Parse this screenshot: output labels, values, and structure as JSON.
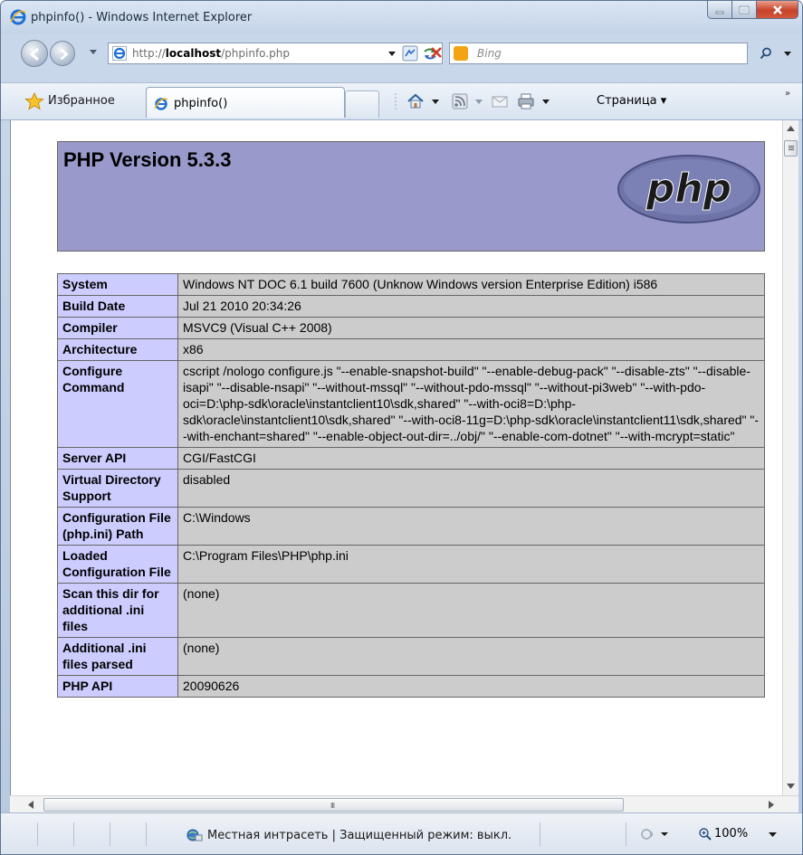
{
  "window": {
    "title": "phpinfo() - Windows Internet Explorer"
  },
  "address_bar": {
    "url_prefix": "http://",
    "url_host": "localhost",
    "url_path": "/phpinfo.php"
  },
  "search": {
    "placeholder": "Bing"
  },
  "favorites_bar": {
    "favorites_label": "Избранное",
    "tab_label": "phpinfo()",
    "page_menu_label": "Страница ▾"
  },
  "php": {
    "version_title": "PHP Version 5.3.3",
    "logo_text": "php",
    "rows": [
      {
        "key": "System",
        "value": "Windows NT DOC 6.1 build 7600 (Unknow Windows version Enterprise Edition) i586"
      },
      {
        "key": "Build Date",
        "value": "Jul 21 2010 20:34:26"
      },
      {
        "key": "Compiler",
        "value": "MSVC9 (Visual C++ 2008)"
      },
      {
        "key": "Architecture",
        "value": "x86"
      },
      {
        "key": "Configure Command",
        "value": "cscript /nologo configure.js \"--enable-snapshot-build\" \"--enable-debug-pack\" \"--disable-zts\" \"--disable-isapi\" \"--disable-nsapi\" \"--without-mssql\" \"--without-pdo-mssql\" \"--without-pi3web\" \"--with-pdo-oci=D:\\php-sdk\\oracle\\instantclient10\\sdk,shared\" \"--with-oci8=D:\\php-sdk\\oracle\\instantclient10\\sdk,shared\" \"--with-oci8-11g=D:\\php-sdk\\oracle\\instantclient11\\sdk,shared\" \"--with-enchant=shared\" \"--enable-object-out-dir=../obj/\" \"--enable-com-dotnet\" \"--with-mcrypt=static\""
      },
      {
        "key": "Server API",
        "value": "CGI/FastCGI"
      },
      {
        "key": "Virtual Directory Support",
        "value": "disabled"
      },
      {
        "key": "Configuration File (php.ini) Path",
        "value": "C:\\Windows"
      },
      {
        "key": "Loaded Configuration File",
        "value": "C:\\Program Files\\PHP\\php.ini"
      },
      {
        "key": "Scan this dir for additional .ini files",
        "value": "(none)"
      },
      {
        "key": "Additional .ini files parsed",
        "value": "(none)"
      },
      {
        "key": "PHP API",
        "value": "20090626"
      }
    ]
  },
  "statusbar": {
    "zone_text": "Местная интрасеть | Защищенный режим: выкл.",
    "zoom_text": "100%"
  },
  "hscroll": {
    "grip": "III"
  },
  "colors": {
    "php_header_bg": "#9999cc",
    "php_key_bg": "#ccccff",
    "php_value_bg": "#cccccc"
  }
}
